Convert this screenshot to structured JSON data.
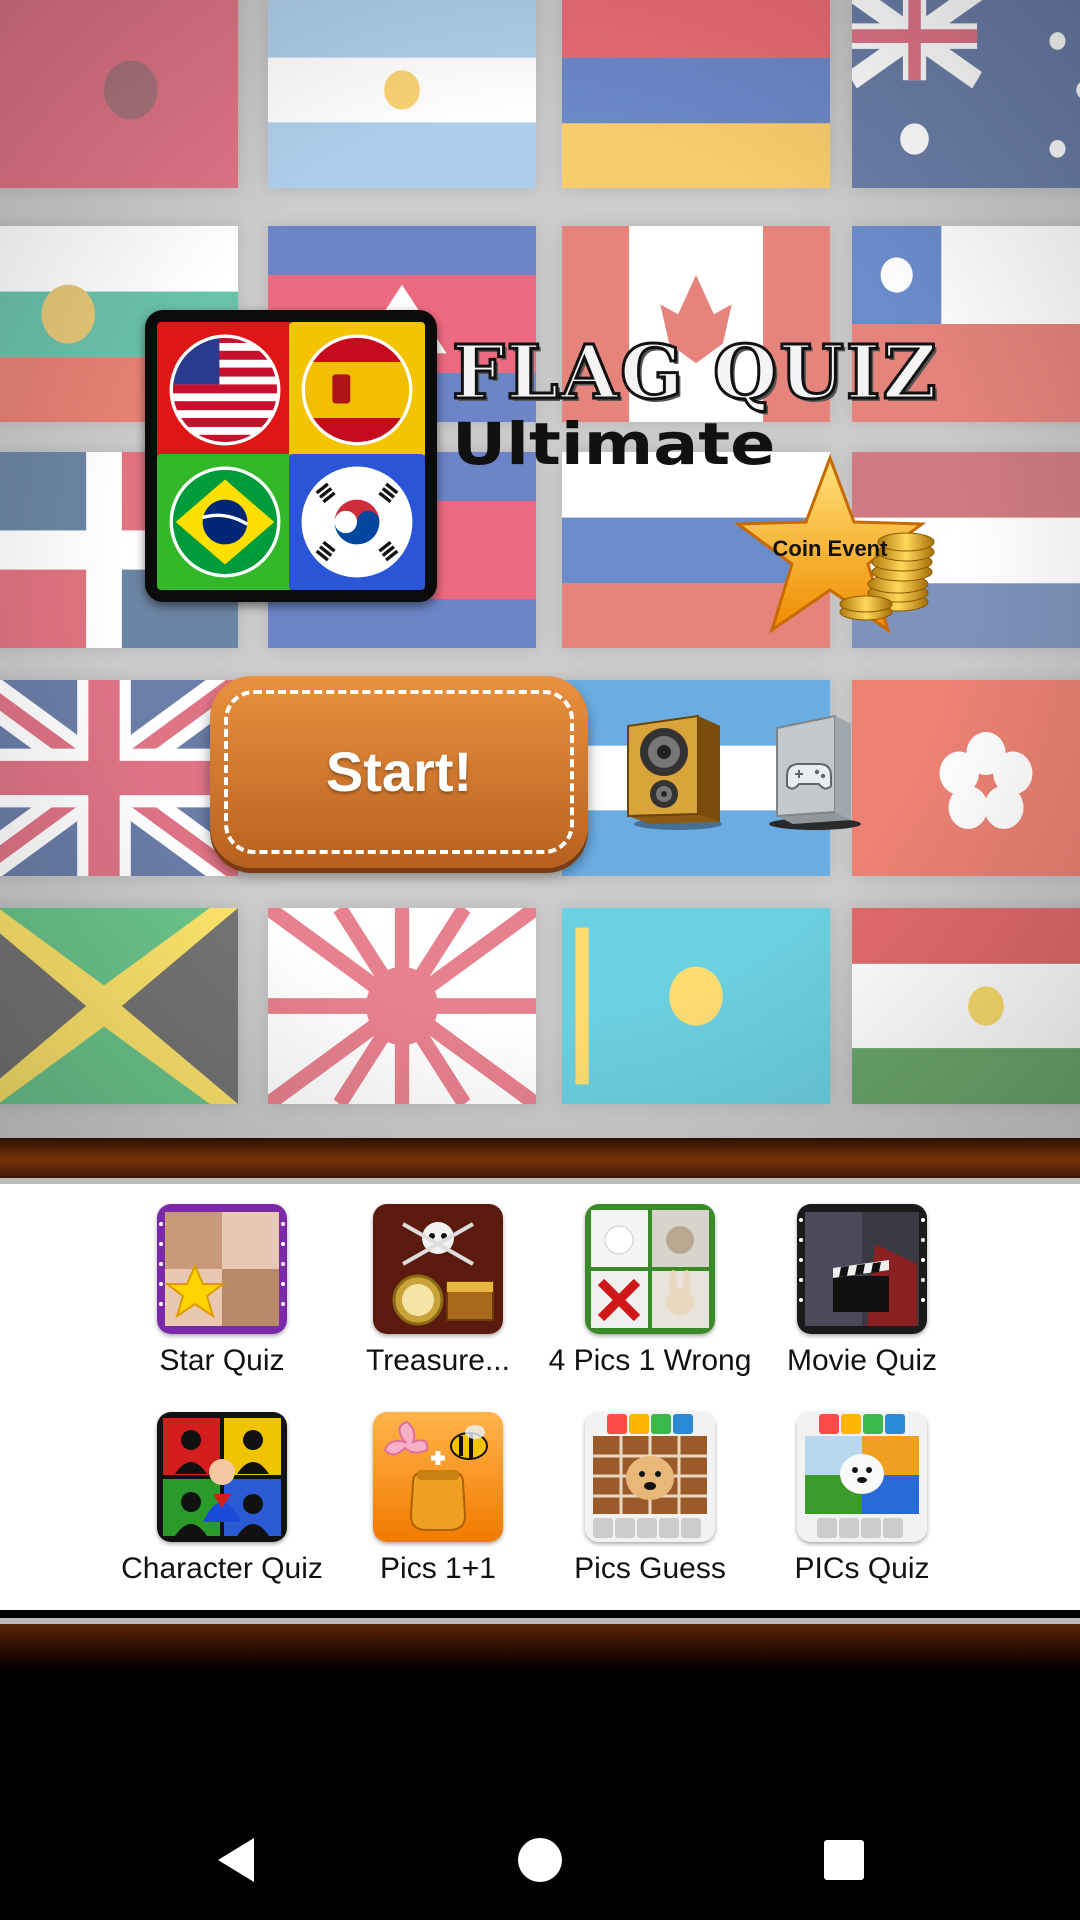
{
  "app": {
    "title_line1": "FLAG QUIZ",
    "title_line2": "Ultimate",
    "coin_event_label": "Coin Event",
    "start_label": "Start!",
    "sound_icon": "speaker-icon",
    "games_icon": "gamepad-icon",
    "logo_flags": [
      "usa",
      "spain",
      "brazil",
      "south-korea"
    ]
  },
  "background_flags": [
    "albania",
    "argentina",
    "armenia",
    "australia",
    "bulgaria",
    "cambodia",
    "canada",
    "chile",
    "dominican-republic",
    "cambodia-2",
    "russia",
    "netherlands",
    "united-kingdom",
    "honduras",
    "hong-kong",
    "jamaica",
    "rising-sun",
    "kazakhstan",
    "tajikistan"
  ],
  "more_apps": [
    {
      "label": "Star Quiz",
      "icon": "star-quiz-icon"
    },
    {
      "label": "Treasure...",
      "icon": "treasure-icon"
    },
    {
      "label": "4 Pics 1 Wrong",
      "icon": "four-pics-icon"
    },
    {
      "label": "Movie Quiz",
      "icon": "movie-quiz-icon"
    },
    {
      "label": "Character Quiz",
      "icon": "character-quiz-icon"
    },
    {
      "label": "Pics 1+1",
      "icon": "pics-one-plus-one-icon"
    },
    {
      "label": "Pics Guess",
      "icon": "pics-guess-icon"
    },
    {
      "label": "PICs Quiz",
      "icon": "pics-quiz-icon"
    }
  ],
  "navbar": {
    "back": "back-icon",
    "home": "home-icon",
    "recents": "recents-icon"
  },
  "colors": {
    "button_orange": "#d47a2e",
    "wood": "#7a3308",
    "banner_bg": "#ffffff"
  }
}
